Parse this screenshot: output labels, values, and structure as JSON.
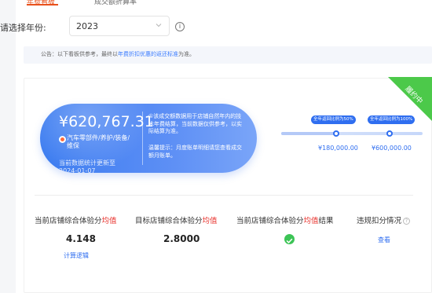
{
  "tabs": [
    {
      "label": "年费看板",
      "active": true
    },
    {
      "label": "成交额折算率",
      "active": false
    }
  ],
  "year_filter": {
    "label": "请选择年份:",
    "value": "2023"
  },
  "notice": {
    "prefix": "公告：以下看板供参考，最终以",
    "link": "年费折扣优惠的返还标准",
    "suffix": "为准。"
  },
  "status_ribbon": "履约中",
  "summary": {
    "amount": "¥620,767.31",
    "category": "汽车零部件/养护/装备/维保",
    "update_line1": "当前数据统计更新至",
    "update_date": "2024-01-07",
    "note1": "①该成交额数据用于店铺自然年内的技术年费结算，当前数据仅供参考，以实际结算为准。",
    "note2": "温馨提示：月度账单明细请您查看成交额月账单。"
  },
  "thresholds": [
    {
      "bubble": "全年返回比例为50%",
      "value": "¥180,000.00"
    },
    {
      "bubble": "全年返回比例为100%",
      "value": "¥600,000.00"
    }
  ],
  "metrics": {
    "col1": {
      "label_a": "当前店铺综合体验分",
      "label_red": "均值",
      "value": "4.148",
      "link": "计算逻辑"
    },
    "col2": {
      "label_a": "目标店铺综合体验分",
      "label_red": "均值",
      "value": "2.8000"
    },
    "col3": {
      "label_a": "当前店铺综合体验分",
      "label_red": "均值",
      "label_b": "结果"
    },
    "col4": {
      "label": "违规扣分情况",
      "link": "查看"
    }
  },
  "colors": {
    "accent": "#e8511c",
    "primary_blue": "#2f6ef0",
    "success_green": "#3cc456",
    "ribbon_green": "#4cc94a"
  }
}
